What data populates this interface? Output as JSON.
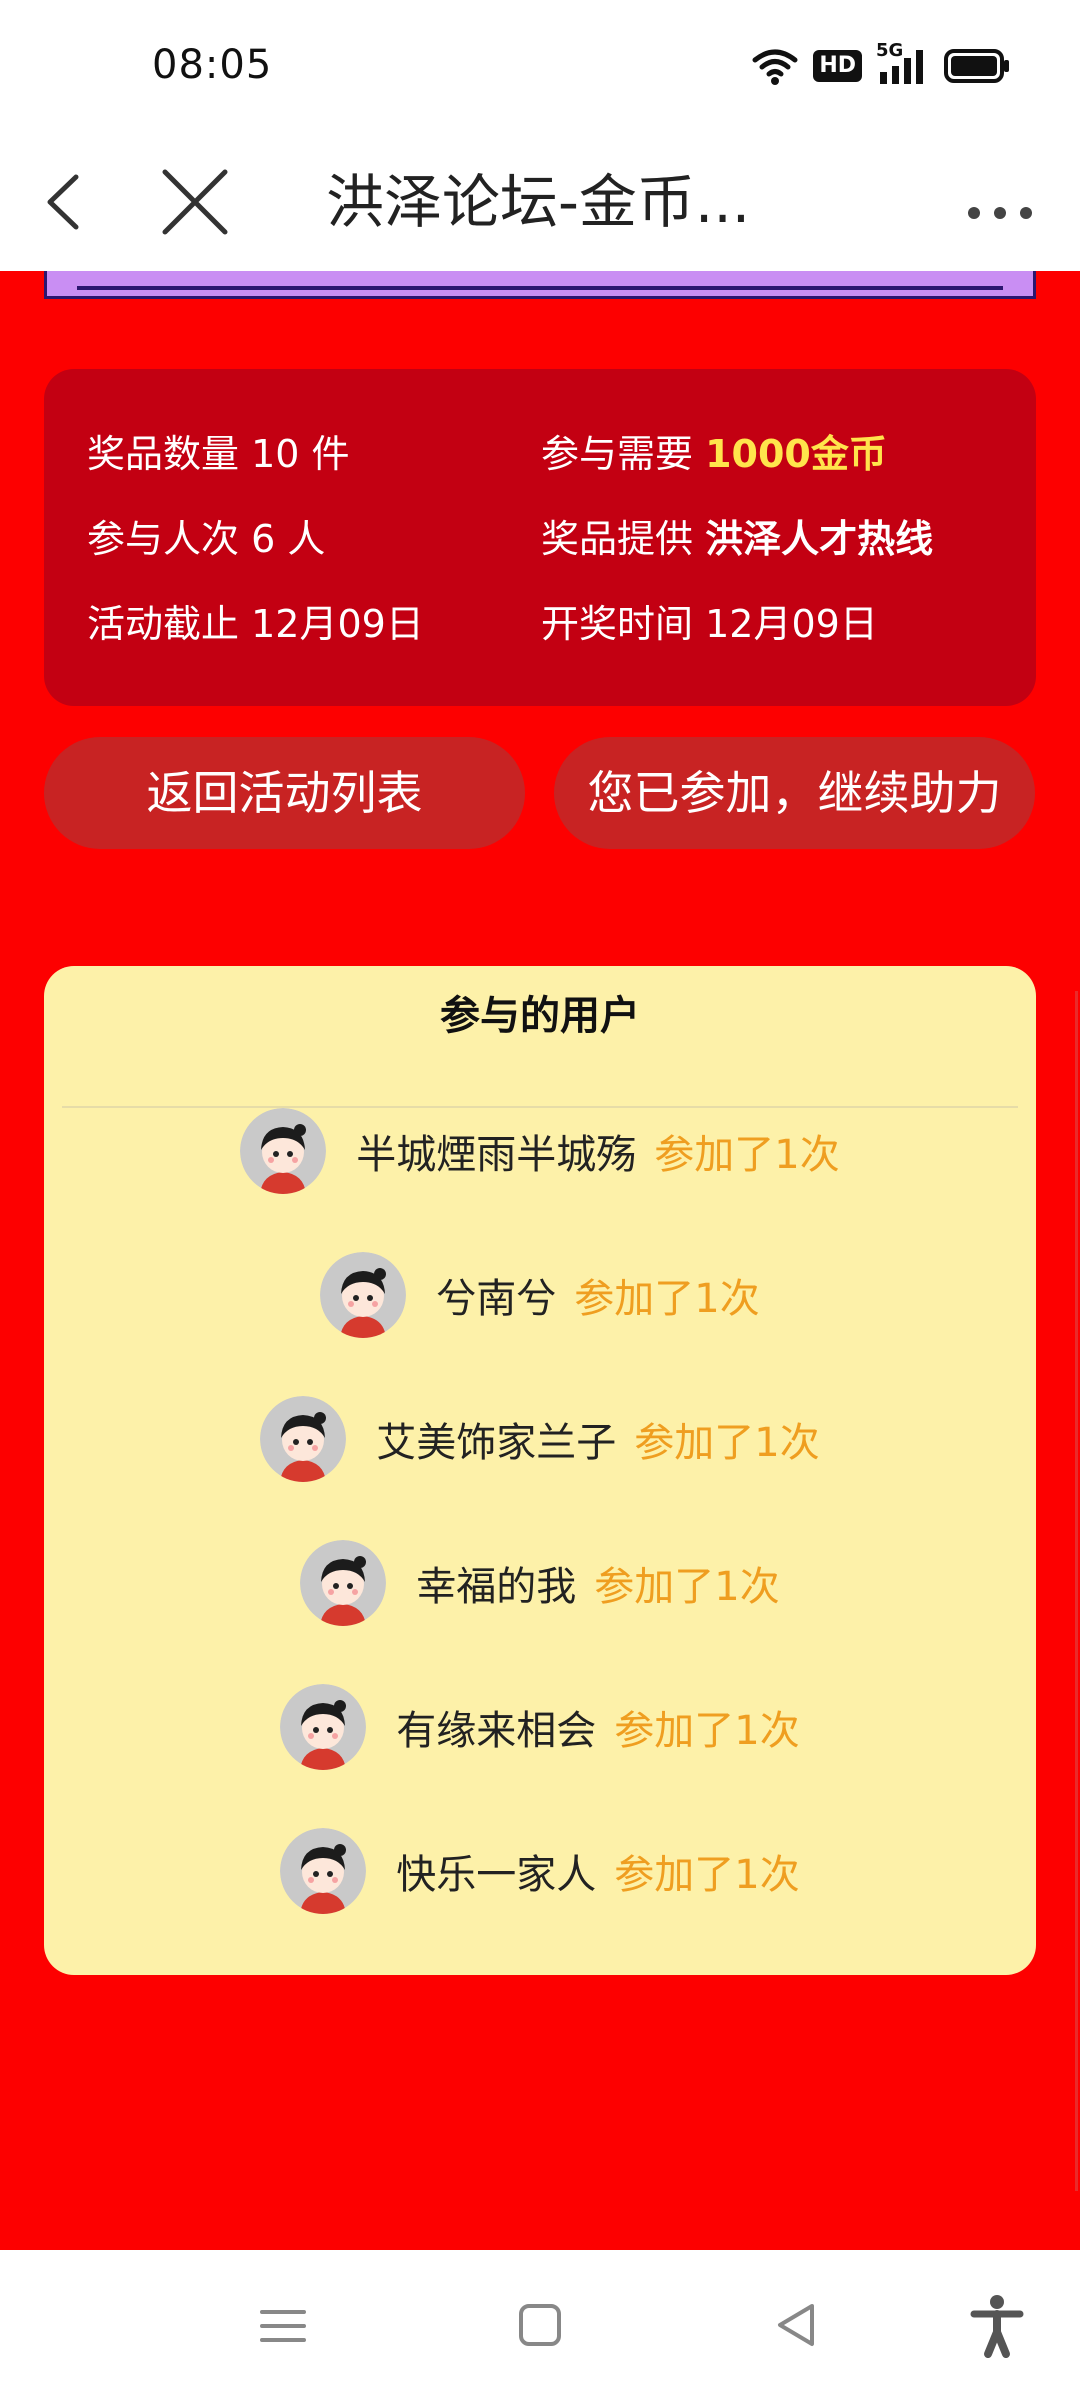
{
  "status_bar": {
    "time": "08:05",
    "hd_label": "HD",
    "network_label": "5G"
  },
  "nav": {
    "title": "洪泽论坛-金币..."
  },
  "info": {
    "prize_count": {
      "label": "奖品数量",
      "value": "10 件"
    },
    "required": {
      "label": "参与需要",
      "value": "1000金币"
    },
    "participants": {
      "label": "参与人次",
      "value": "6 人"
    },
    "provider": {
      "label": "奖品提供",
      "value": "洪泽人才热线"
    },
    "deadline": {
      "label": "活动截止",
      "value": "12月09日"
    },
    "draw_time": {
      "label": "开奖时间",
      "value": "12月09日"
    }
  },
  "buttons": {
    "back_to_list": "返回活动列表",
    "continue": "您已参加，继续助力"
  },
  "users_section": {
    "title": "参与的用户",
    "users": [
      {
        "name": "半城煙雨半城殇",
        "count": "参加了1次"
      },
      {
        "name": "兮南兮",
        "count": "参加了1次"
      },
      {
        "name": "艾美饰家兰子",
        "count": "参加了1次"
      },
      {
        "name": "幸福的我",
        "count": "参加了1次"
      },
      {
        "name": "有缘来相会",
        "count": "参加了1次"
      },
      {
        "name": "快乐一家人",
        "count": "参加了1次"
      }
    ]
  },
  "colors": {
    "page_bg": "#fd0000",
    "card_bg": "#c30012",
    "button_bg": "#c82323",
    "users_card_bg": "#fdf1a9",
    "accent_gold": "#ffe44c",
    "count_orange": "#ef9e20"
  }
}
